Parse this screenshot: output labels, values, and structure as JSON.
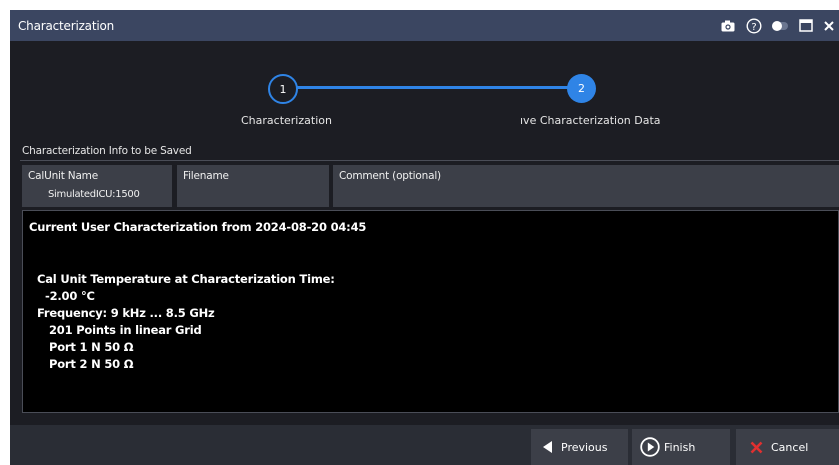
{
  "window": {
    "title": "Characterization"
  },
  "titlebar_icons": [
    "camera-icon",
    "help-icon",
    "toggle-icon",
    "maximize-icon",
    "close-icon"
  ],
  "stepper": {
    "steps": [
      {
        "number": "1",
        "label": "Characterization",
        "state": "done"
      },
      {
        "number": "2",
        "label": "ıve Characterization Data",
        "state": "active"
      }
    ]
  },
  "section": {
    "label": "Characterization Info to be Saved"
  },
  "fields": {
    "calunit": {
      "label": "CalUnit Name",
      "value": "SimulatedICU:1500"
    },
    "filename": {
      "label": "Filename",
      "value": ""
    },
    "comment": {
      "label": "Comment (optional)",
      "value": ""
    }
  },
  "info": {
    "lines": [
      "Current User Characterization from 2024-08-20 04:45",
      "Cal Unit Temperature at Characterization Time:",
      "-2.00 °C",
      "Frequency: 9 kHz ... 8.5 GHz",
      "201 Points in linear Grid",
      "Port 1 N 50 Ω",
      "Port 2 N 50 Ω"
    ]
  },
  "footer": {
    "previous": "Previous",
    "finish": "Finish",
    "cancel": "Cancel"
  },
  "colors": {
    "accent": "#2f84e6",
    "titlebar": "#3b4661",
    "cancel_x": "#e03030"
  }
}
